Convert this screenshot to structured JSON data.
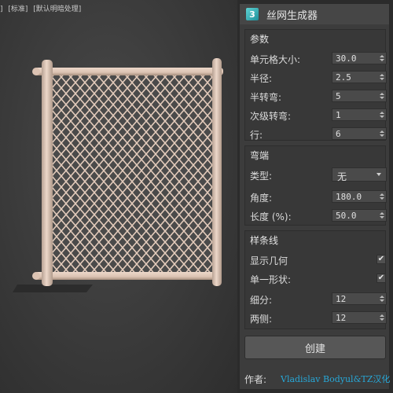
{
  "viewport": {
    "label_parts": [
      "]",
      "[标准]",
      "[默认明暗处理]"
    ]
  },
  "colors": {
    "fence": "#e6cdbd",
    "fence_shadow": "#b89e8f",
    "link_blue": "#27a8d8"
  },
  "panel": {
    "icon_text": "3",
    "title": "丝网生成器",
    "params": {
      "title": "参数",
      "rows": [
        {
          "label": "单元格大小:",
          "value": "30.0"
        },
        {
          "label": "半径:",
          "value": "2.5"
        },
        {
          "label": "半转弯:",
          "value": "5"
        },
        {
          "label": "次级转弯:",
          "value": "1"
        },
        {
          "label": "行:",
          "value": "6"
        }
      ]
    },
    "ends": {
      "title": "弯端",
      "type_label": "类型:",
      "type_value": "无",
      "rows": [
        {
          "label": "角度:",
          "value": "180.0"
        },
        {
          "label": "长度 (%):",
          "value": "50.0"
        }
      ]
    },
    "spline": {
      "title": "样条线",
      "show_geometry_label": "显示几何",
      "show_geometry_checked": "✔",
      "single_shape_label": "单一形状:",
      "single_shape_checked": "✔",
      "rows": [
        {
          "label": "细分:",
          "value": "12"
        },
        {
          "label": "两侧:",
          "value": "12"
        }
      ]
    },
    "create_label": "创建",
    "author_label": "作者:",
    "author_name": "Vladislav Bodyul&TZ汉化"
  }
}
